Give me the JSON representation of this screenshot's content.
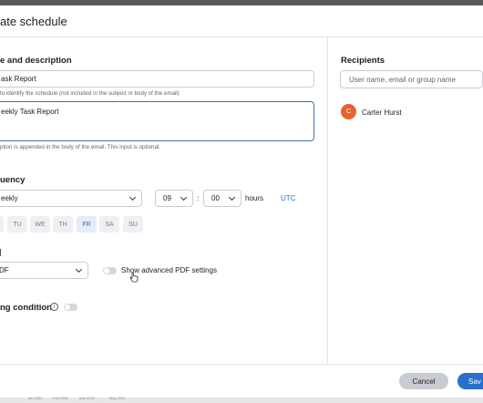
{
  "header": {
    "title": "ate schedule"
  },
  "name_section": {
    "heading": "e and description",
    "name_value": "ask Report",
    "name_hint": "to identify the schedule (not included in the subject or body of the email)",
    "description_value": "eekly Task Report",
    "description_hint": "ption is appended in the body of the email. This input is optional."
  },
  "frequency": {
    "heading": "uency",
    "frequency_value": "eekly",
    "hour_value": "09",
    "separator": ":",
    "minute_value": "00",
    "hours_label": "hours",
    "timezone": "UTC",
    "days": [
      {
        "label": "",
        "active": false
      },
      {
        "label": "TU",
        "active": false
      },
      {
        "label": "WE",
        "active": false
      },
      {
        "label": "TH",
        "active": false
      },
      {
        "label": "FR",
        "active": true
      },
      {
        "label": "SA",
        "active": false
      },
      {
        "label": "SU",
        "active": false
      }
    ]
  },
  "format": {
    "value": "DF",
    "advanced_label": "Show advanced PDF settings"
  },
  "condition": {
    "label": "ng condition",
    "info_icon": "info-icon"
  },
  "recipients": {
    "heading": "Recipients",
    "search_placeholder": "User name, email or group name",
    "list": [
      {
        "initial": "C",
        "name": "Carter Hurst"
      }
    ]
  },
  "footer": {
    "cancel_label": "Cancel",
    "save_label": "Sav"
  },
  "background_strip": {
    "labels": [
      "Jan 2022",
      "Feb 2022",
      "Mar 2022",
      "May 2022"
    ]
  },
  "colors": {
    "accent": "#2a6fc9",
    "avatar": "#e8622f"
  }
}
